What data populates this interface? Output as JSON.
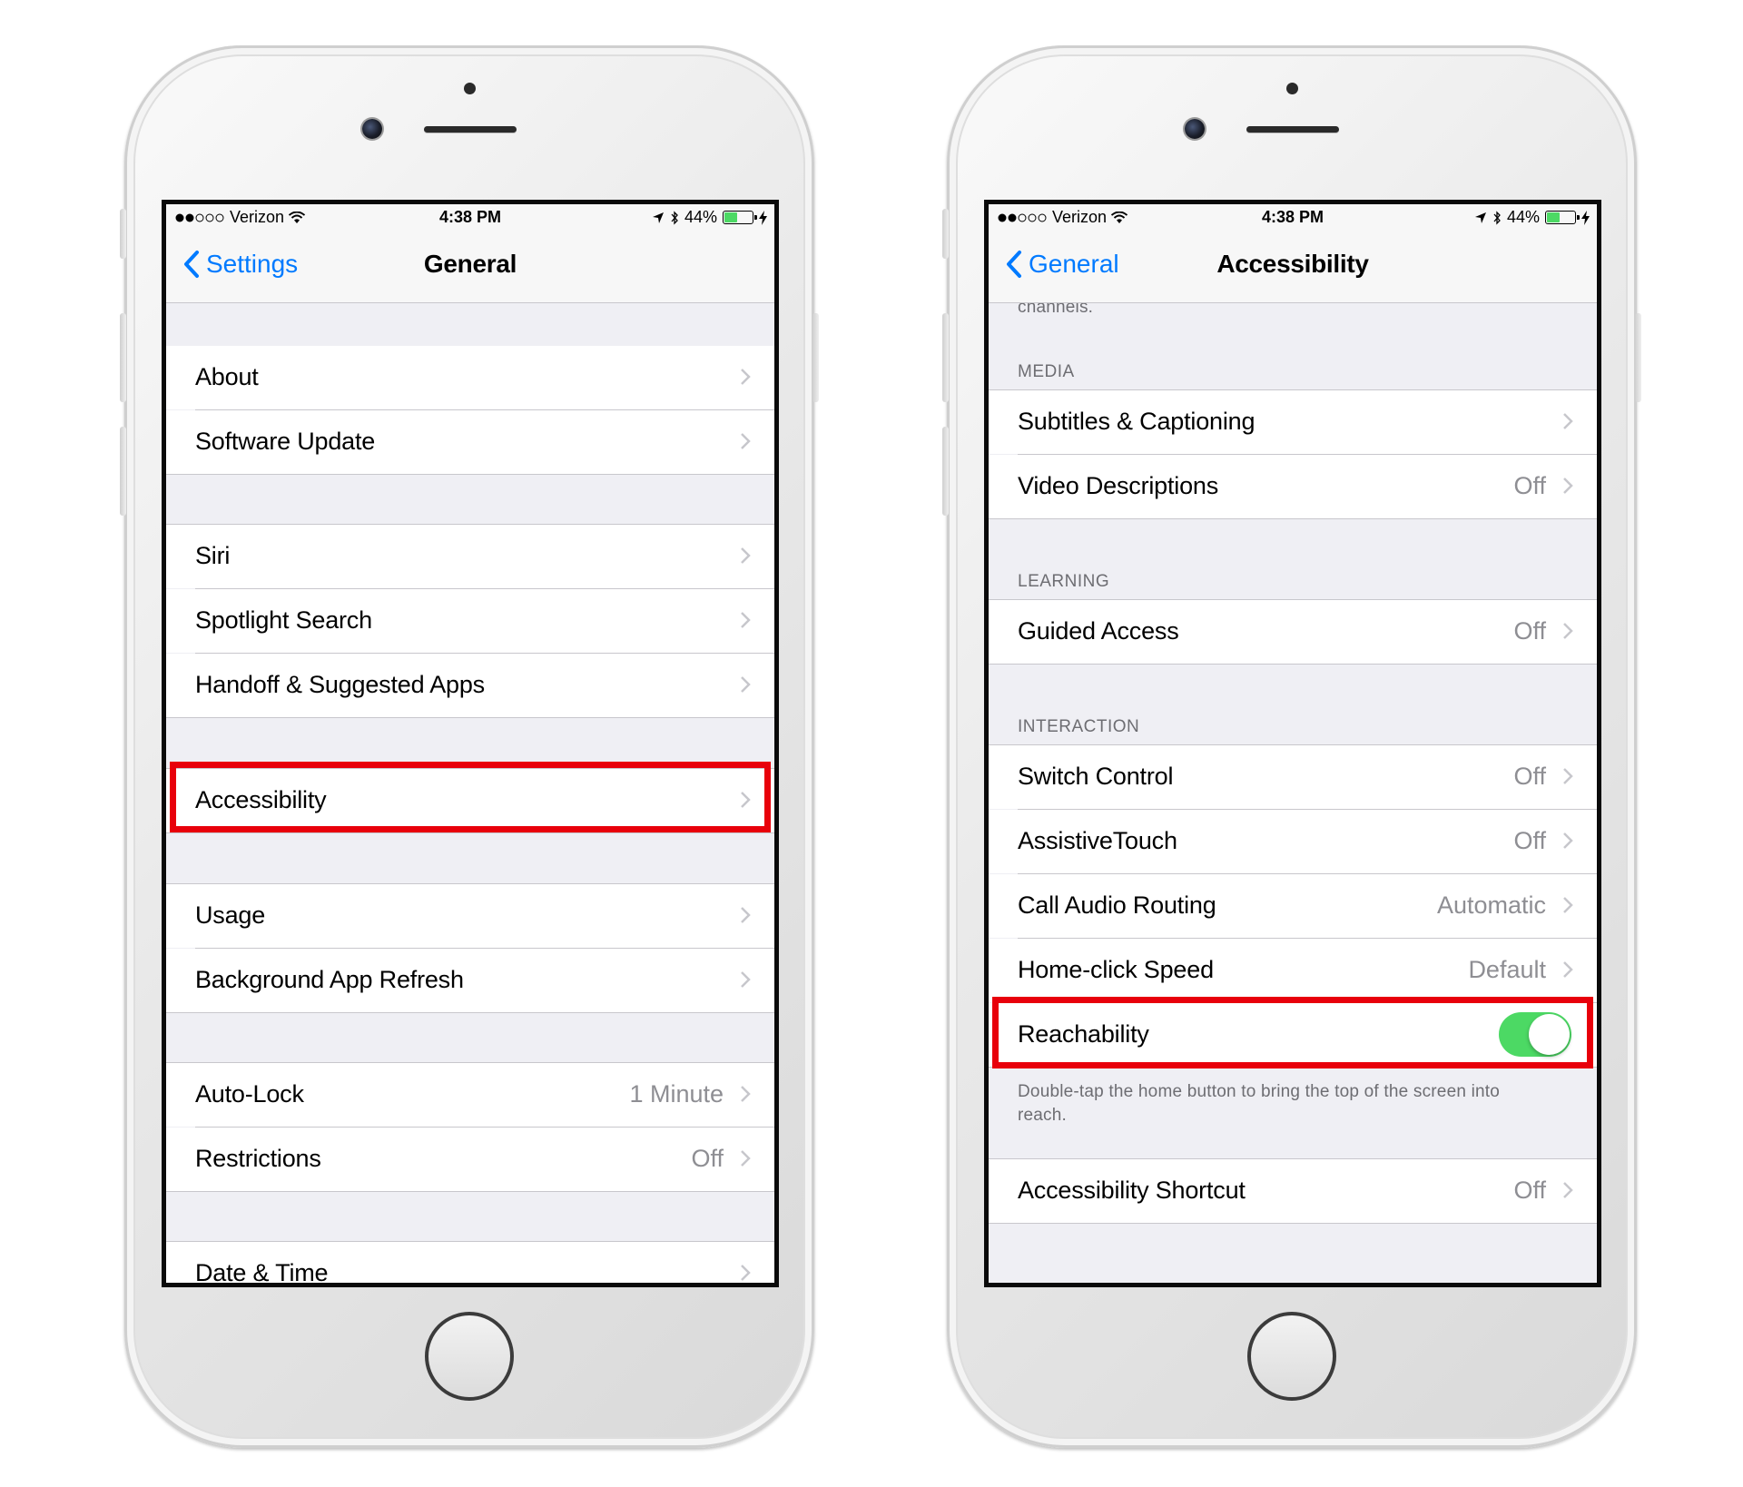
{
  "status_bar": {
    "carrier": "Verizon",
    "time": "4:38 PM",
    "battery": "44%",
    "battery_level": 0.44
  },
  "left_phone": {
    "nav": {
      "back_label": "Settings",
      "title": "General"
    },
    "rows": [
      {
        "label": "About"
      },
      {
        "label": "Software Update"
      },
      {
        "label": "Siri"
      },
      {
        "label": "Spotlight Search"
      },
      {
        "label": "Handoff & Suggested Apps"
      },
      {
        "label": "Accessibility"
      },
      {
        "label": "Usage"
      },
      {
        "label": "Background App Refresh"
      },
      {
        "label": "Auto-Lock",
        "value": "1 Minute"
      },
      {
        "label": "Restrictions",
        "value": "Off"
      },
      {
        "label": "Date & Time"
      }
    ]
  },
  "right_phone": {
    "nav": {
      "back_label": "General",
      "title": "Accessibility"
    },
    "partial_text": "channels.",
    "sections": {
      "media": "MEDIA",
      "learning": "LEARNING",
      "interaction": "INTERACTION"
    },
    "rows": [
      {
        "label": "Subtitles & Captioning"
      },
      {
        "label": "Video Descriptions",
        "value": "Off"
      },
      {
        "label": "Guided Access",
        "value": "Off"
      },
      {
        "label": "Switch Control",
        "value": "Off"
      },
      {
        "label": "AssistiveTouch",
        "value": "Off"
      },
      {
        "label": "Call Audio Routing",
        "value": "Automatic"
      },
      {
        "label": "Home-click Speed",
        "value": "Default"
      },
      {
        "label": "Reachability",
        "toggle_on": true
      },
      {
        "label": "Accessibility Shortcut",
        "value": "Off"
      }
    ],
    "reachability_note": "Double-tap the home button to bring the top of the screen into reach."
  },
  "colors": {
    "ios_blue": "#007aff",
    "toggle_green": "#4cd964",
    "highlight_red": "#e8000b",
    "group_background": "#efeff4"
  }
}
